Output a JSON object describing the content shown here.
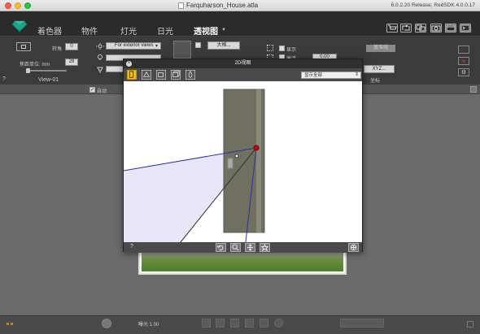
{
  "window": {
    "title": "Farquharson_House.atla",
    "version": "6.0.2.20 Release; RedSDK 4.0.0.17"
  },
  "menu": {
    "items": [
      {
        "label": "着色器"
      },
      {
        "label": "物件"
      },
      {
        "label": "灯光"
      },
      {
        "label": "日光"
      },
      {
        "label": "透视图"
      }
    ],
    "active": "透视图"
  },
  "toolbar": {
    "rotate_label": "转角",
    "rotate_value": "0",
    "lens_label": "焦距单位: mm",
    "lens_value": "28",
    "view_name": "View-01",
    "exterior_select": "For exterior views",
    "big_button": "大格...",
    "show_label": "显示",
    "activate_label": "激活",
    "value_box": "0.00",
    "xyz_button": "XYZ...",
    "coord_label": "坐标",
    "auto_label": "自动",
    "right_field": "基准线",
    "help": "?"
  },
  "dialog": {
    "title": "2D视图",
    "close": "×",
    "display_select": "显示全部",
    "help": "?"
  },
  "bottombar": {
    "exposure_label": "曝光 1.00"
  },
  "colors": {
    "menubar": "#2b2b2b",
    "toolbar": "#3b3b3b",
    "viewport": "#6b6b6b",
    "active_tool": "#f0b830",
    "camera_point": "#cc0022",
    "frustum_line": "#3030a0"
  }
}
